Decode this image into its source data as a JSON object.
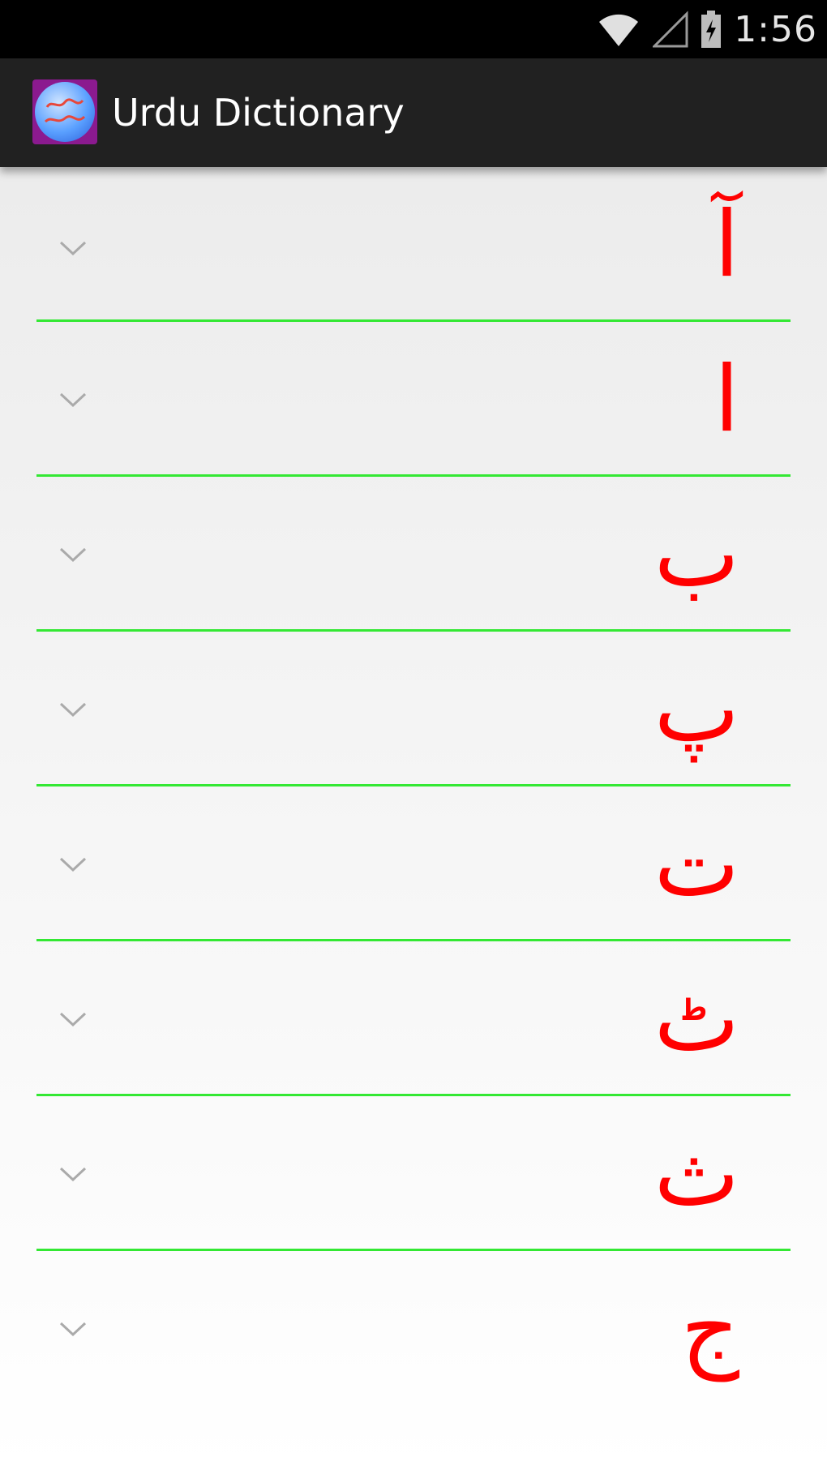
{
  "status_bar": {
    "time": "1:56",
    "icons": [
      "wifi-icon",
      "cell-signal-icon",
      "battery-charging-icon"
    ]
  },
  "action_bar": {
    "title": "Urdu Dictionary",
    "icon": "app-logo-icon",
    "background": "#212121"
  },
  "letters": [
    {
      "letter": "آ"
    },
    {
      "letter": "ا"
    },
    {
      "letter": "ب"
    },
    {
      "letter": "پ"
    },
    {
      "letter": "ت"
    },
    {
      "letter": "ٹ"
    },
    {
      "letter": "ث"
    },
    {
      "letter": "ج"
    }
  ],
  "colors": {
    "letter": "#ff0000",
    "divider": "#33e833",
    "chevron": "#aaaaaa"
  }
}
